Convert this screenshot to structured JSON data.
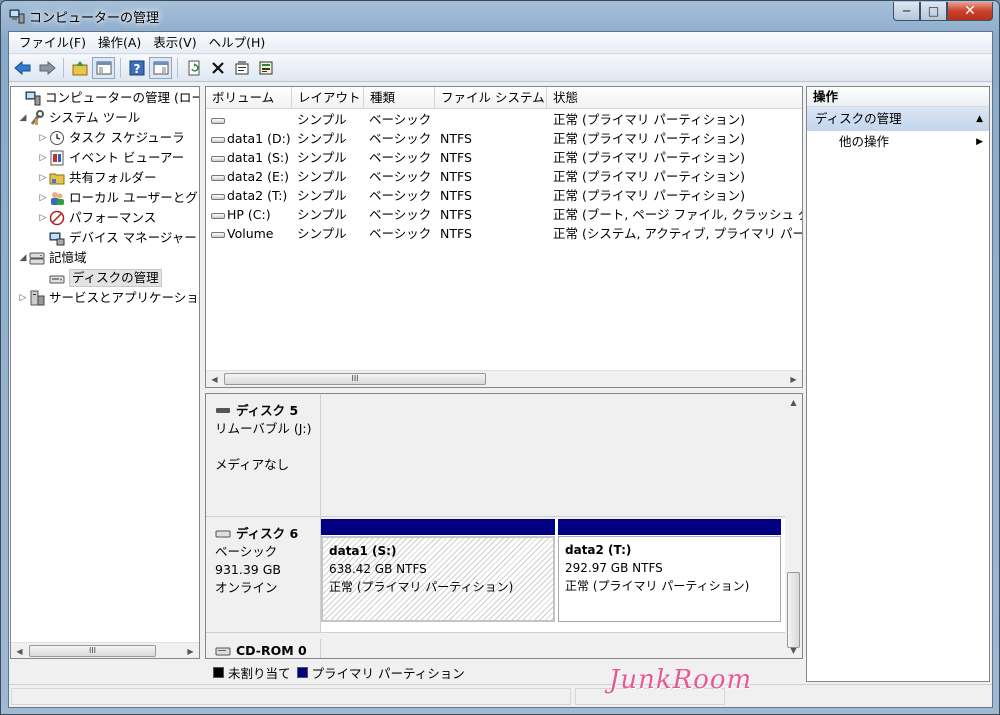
{
  "window": {
    "title": "コンピューターの管理",
    "icon": "computer-management-icon",
    "buttons": {
      "minimize": "─",
      "maximize": "□",
      "close": "✕"
    }
  },
  "menu": [
    "ファイル(F)",
    "操作(A)",
    "表示(V)",
    "ヘルプ(H)"
  ],
  "toolbar": [
    "back-icon",
    "forward-icon",
    "up-icon",
    "console-tree-icon",
    "help-icon",
    "action-pane-icon",
    "refresh-icon",
    "delete-icon",
    "properties-icon",
    "export-icon"
  ],
  "tree": {
    "items": [
      {
        "label": "コンピューターの管理 (ローカ",
        "level": 0,
        "expander": "",
        "icon": "computer-management-icon"
      },
      {
        "label": "システム ツール",
        "level": 1,
        "expander": "◢",
        "icon": "tools-icon"
      },
      {
        "label": "タスク スケジューラ",
        "level": 2,
        "expander": "▷",
        "icon": "clock-icon"
      },
      {
        "label": "イベント ビューアー",
        "level": 2,
        "expander": "▷",
        "icon": "event-viewer-icon"
      },
      {
        "label": "共有フォルダー",
        "level": 2,
        "expander": "▷",
        "icon": "shared-folder-icon"
      },
      {
        "label": "ローカル ユーザーとグ",
        "level": 2,
        "expander": "▷",
        "icon": "users-icon"
      },
      {
        "label": "パフォーマンス",
        "level": 2,
        "expander": "▷",
        "icon": "performance-icon"
      },
      {
        "label": "デバイス マネージャー",
        "level": 2,
        "expander": "",
        "icon": "device-manager-icon"
      },
      {
        "label": "記憶域",
        "level": 1,
        "expander": "◢",
        "icon": "storage-icon"
      },
      {
        "label": "ディスクの管理",
        "level": 2,
        "expander": "",
        "icon": "disk-management-icon",
        "selected": true
      },
      {
        "label": "サービスとアプリケーショ",
        "level": 1,
        "expander": "▷",
        "icon": "services-icon"
      }
    ],
    "scroll_thumb": "III"
  },
  "volumes": {
    "columns": [
      "ボリューム",
      "レイアウト",
      "種類",
      "ファイル システム",
      "状態"
    ],
    "rows": [
      {
        "volume": "",
        "layout": "シンプル",
        "type": "ベーシック",
        "fs": "",
        "status": "正常 (プライマリ パーティション)"
      },
      {
        "volume": "data1 (D:)",
        "layout": "シンプル",
        "type": "ベーシック",
        "fs": "NTFS",
        "status": "正常 (プライマリ パーティション)"
      },
      {
        "volume": "data1 (S:)",
        "layout": "シンプル",
        "type": "ベーシック",
        "fs": "NTFS",
        "status": "正常 (プライマリ パーティション)"
      },
      {
        "volume": "data2 (E:)",
        "layout": "シンプル",
        "type": "ベーシック",
        "fs": "NTFS",
        "status": "正常 (プライマリ パーティション)"
      },
      {
        "volume": "data2 (T:)",
        "layout": "シンプル",
        "type": "ベーシック",
        "fs": "NTFS",
        "status": "正常 (プライマリ パーティション)"
      },
      {
        "volume": "HP (C:)",
        "layout": "シンプル",
        "type": "ベーシック",
        "fs": "NTFS",
        "status": "正常 (ブート, ページ ファイル, クラッシュ ダ"
      },
      {
        "volume": "Volume",
        "layout": "シンプル",
        "type": "ベーシック",
        "fs": "NTFS",
        "status": "正常 (システム, アクティブ, プライマリ パー"
      }
    ],
    "scroll_thumb": "III"
  },
  "disks": [
    {
      "name": "ディスク 5",
      "type": "リムーバブル (J:)",
      "size": "",
      "state": "",
      "note": "メディアなし"
    },
    {
      "name": "ディスク 6",
      "type": "ベーシック",
      "size": "931.39 GB",
      "state": "オンライン",
      "partitions": [
        {
          "name": "data1  (S:)",
          "size": "638.42 GB NTFS",
          "status": "正常 (プライマリ パーティション)"
        },
        {
          "name": "data2  (T:)",
          "size": "292.97 GB NTFS",
          "status": "正常 (プライマリ パーティション)"
        }
      ]
    },
    {
      "name": "CD-ROM 0"
    }
  ],
  "legend": [
    {
      "label": "未割り当て",
      "color": "#000000"
    },
    {
      "label": "プライマリ パーティション",
      "color": "#000080"
    }
  ],
  "actions": {
    "header": "操作",
    "section": "ディスクの管理",
    "items": [
      "他の操作"
    ]
  },
  "watermark": "JunkRoom"
}
